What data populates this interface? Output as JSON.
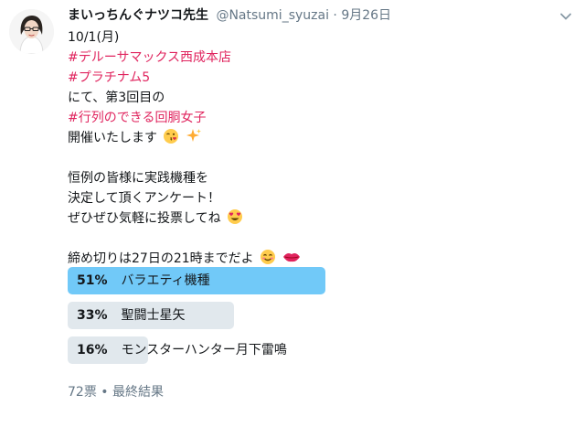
{
  "tweet": {
    "author_name": "まいっちんぐナツコ先生",
    "handle": "@Natsumi_syuzai",
    "separator": "·",
    "date": "9月26日",
    "lines": {
      "l1": "10/1(月)",
      "l2": "#デルーサマックス西成本店",
      "l3": "#プラチナム5",
      "l4": "にて、第3回目の",
      "l5": "#行列のできる回胴女子",
      "l6": "開催いたします",
      "l7": "恒例の皆様に実践機種を",
      "l8": "決定して頂くアンケート！",
      "l9": "ぜひぜひ気軽に投票してね",
      "l10": "締め切りは27日の21時までだよ"
    },
    "icons": [
      "avatar",
      "chevron-down-icon",
      "kiss-face-emoji",
      "sparkles-emoji",
      "heart-eyes-emoji",
      "smile-emoji",
      "lips-emoji"
    ]
  },
  "poll": {
    "choices": [
      {
        "percent": "51%",
        "percent_value": 51,
        "label": "バラエティ機種",
        "winner": true
      },
      {
        "percent": "33%",
        "percent_value": 33,
        "label": "聖闘士星矢",
        "winner": false
      },
      {
        "percent": "16%",
        "percent_value": 16,
        "label": "モンスターハンター月下雷鳴",
        "winner": false
      }
    ],
    "summary": "72票 • 最終結果"
  },
  "colors": {
    "hashtag": "#e0245e",
    "winner_bar": "#71c9f8",
    "other_bar": "#e1e8ed",
    "muted": "#657786"
  }
}
